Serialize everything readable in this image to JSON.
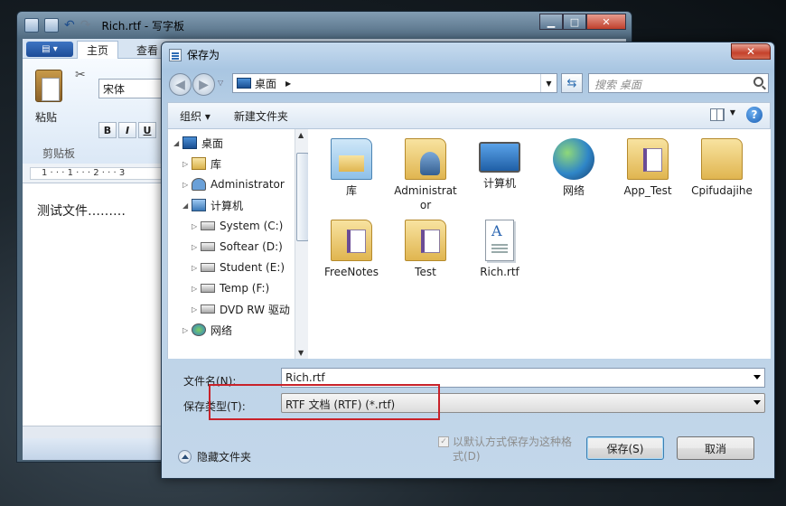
{
  "wordpad": {
    "title": "Rich.rtf - 写字板",
    "tabs": [
      "主页",
      "查看"
    ],
    "font_name": "宋体",
    "clipboard_label": "剪贴板",
    "paste_label": "粘贴",
    "format_buttons": [
      "B",
      "I",
      "U"
    ],
    "ruler_text": "1 · · · 1 · · · 2 · · · 3",
    "document_text": "测试文件………"
  },
  "dialog": {
    "title": "保存为",
    "address": "桌面",
    "search_placeholder": "搜索 桌面",
    "toolbar": {
      "organize": "组织 ▾",
      "new_folder": "新建文件夹"
    },
    "tree": [
      {
        "label": "桌面",
        "icon": "desktop-icon",
        "arrow": "◢",
        "indent": 0
      },
      {
        "label": "库",
        "icon": "library-icon",
        "arrow": "▷",
        "indent": 1
      },
      {
        "label": "Administrator",
        "icon": "user-icon",
        "arrow": "▷",
        "indent": 1
      },
      {
        "label": "计算机",
        "icon": "computer-icon",
        "arrow": "◢",
        "indent": 1
      },
      {
        "label": "System (C:)",
        "icon": "drive-icon",
        "arrow": "▷",
        "indent": 2
      },
      {
        "label": "Softear (D:)",
        "icon": "drive-icon",
        "arrow": "▷",
        "indent": 2
      },
      {
        "label": "Student (E:)",
        "icon": "drive-icon",
        "arrow": "▷",
        "indent": 2
      },
      {
        "label": "Temp (F:)",
        "icon": "drive-icon",
        "arrow": "▷",
        "indent": 2
      },
      {
        "label": "DVD RW 驱动",
        "icon": "dvd-drive-icon",
        "arrow": "▷",
        "indent": 2
      },
      {
        "label": "网络",
        "icon": "network-icon",
        "arrow": "▷",
        "indent": 1
      }
    ],
    "files": [
      {
        "label": "库",
        "icon": "library-folder-icon"
      },
      {
        "label": "Administrator",
        "icon": "user-folder-icon"
      },
      {
        "label": "计算机",
        "icon": "computer-icon"
      },
      {
        "label": "网络",
        "icon": "network-icon"
      },
      {
        "label": "App_Test",
        "icon": "vs-folder-icon"
      },
      {
        "label": "Cpifudajihe",
        "icon": "folder-icon"
      },
      {
        "label": "FreeNotes",
        "icon": "vs-folder-icon"
      },
      {
        "label": "Test",
        "icon": "vs-folder-icon"
      },
      {
        "label": "Rich.rtf",
        "icon": "rtf-file-icon"
      }
    ],
    "filename_label": "文件名(N):",
    "filename_value": "Rich.rtf",
    "filetype_label": "保存类型(T):",
    "filetype_value": "RTF 文档 (RTF) (*.rtf)",
    "hide_folders": "隐藏文件夹",
    "default_checkbox": "以默认方式保存为这种格式(D)",
    "save_button": "保存(S)",
    "cancel_button": "取消",
    "highlight_color": "#c8222a"
  }
}
